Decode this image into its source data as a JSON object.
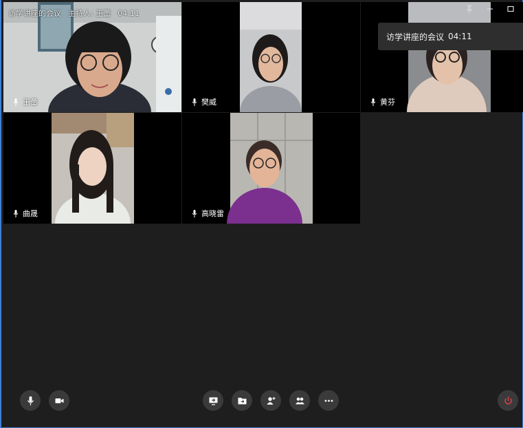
{
  "title_bar": {
    "meeting_name": "访学讲座的会议",
    "host_label": "主持人: 王蕾",
    "timer": "04:11"
  },
  "tooltip": {
    "meeting_name": "访学讲座的会议",
    "timer": "04:11"
  },
  "participants": [
    {
      "name": "王蕾"
    },
    {
      "name": "樊威"
    },
    {
      "name": "黄芬"
    },
    {
      "name": "曲晟"
    },
    {
      "name": "高晓雷"
    }
  ],
  "window_controls": [
    "pin-icon",
    "minimize-icon",
    "maximize-icon"
  ],
  "toolbar": {
    "left": [
      "microphone-icon",
      "camera-icon"
    ],
    "center": [
      "share-screen-icon",
      "share-file-icon",
      "invite-member-icon",
      "members-icon",
      "more-icon"
    ],
    "right": [
      "leave-meeting-icon"
    ]
  },
  "colors": {
    "background": "#1e1e1e",
    "tile_background": "#000000",
    "button_background": "#3a3a3a",
    "leave_icon": "#e2404c",
    "window_border": "#3d7fd6"
  }
}
